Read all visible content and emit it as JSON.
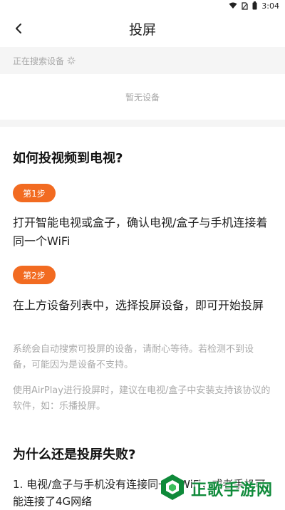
{
  "status_bar": {
    "time": "3:04"
  },
  "header": {
    "title": "投屏"
  },
  "search": {
    "status": "正在搜索设备"
  },
  "device_list": {
    "empty_text": "暂无设备"
  },
  "guide": {
    "heading": "如何投视频到电视?",
    "steps": [
      {
        "badge": "第1步",
        "text": "打开智能电视或盒子，确认电视/盒子与手机连接着同一个WiFi"
      },
      {
        "badge": "第2步",
        "text": "在上方设备列表中，选择投屏设备，即可开始投屏"
      }
    ],
    "notes": [
      "系统会自动搜索可投屏的设备，请耐心等待。若检测不到设备，可能因为是设备不支持。",
      "使用AirPlay进行投屏时，建议在电视/盒子中安装支持该协议的软件，如：乐播投屏。"
    ]
  },
  "failure": {
    "heading": "为什么还是投屏失败?",
    "items": [
      "1. 电视/盒子与手机没有连接同一个WiFi，或者手机可能连接了4G网络"
    ]
  },
  "watermark": {
    "text": "正歌手游网"
  },
  "colors": {
    "accent": "#f26b21",
    "watermark": "#0f8a3a"
  }
}
